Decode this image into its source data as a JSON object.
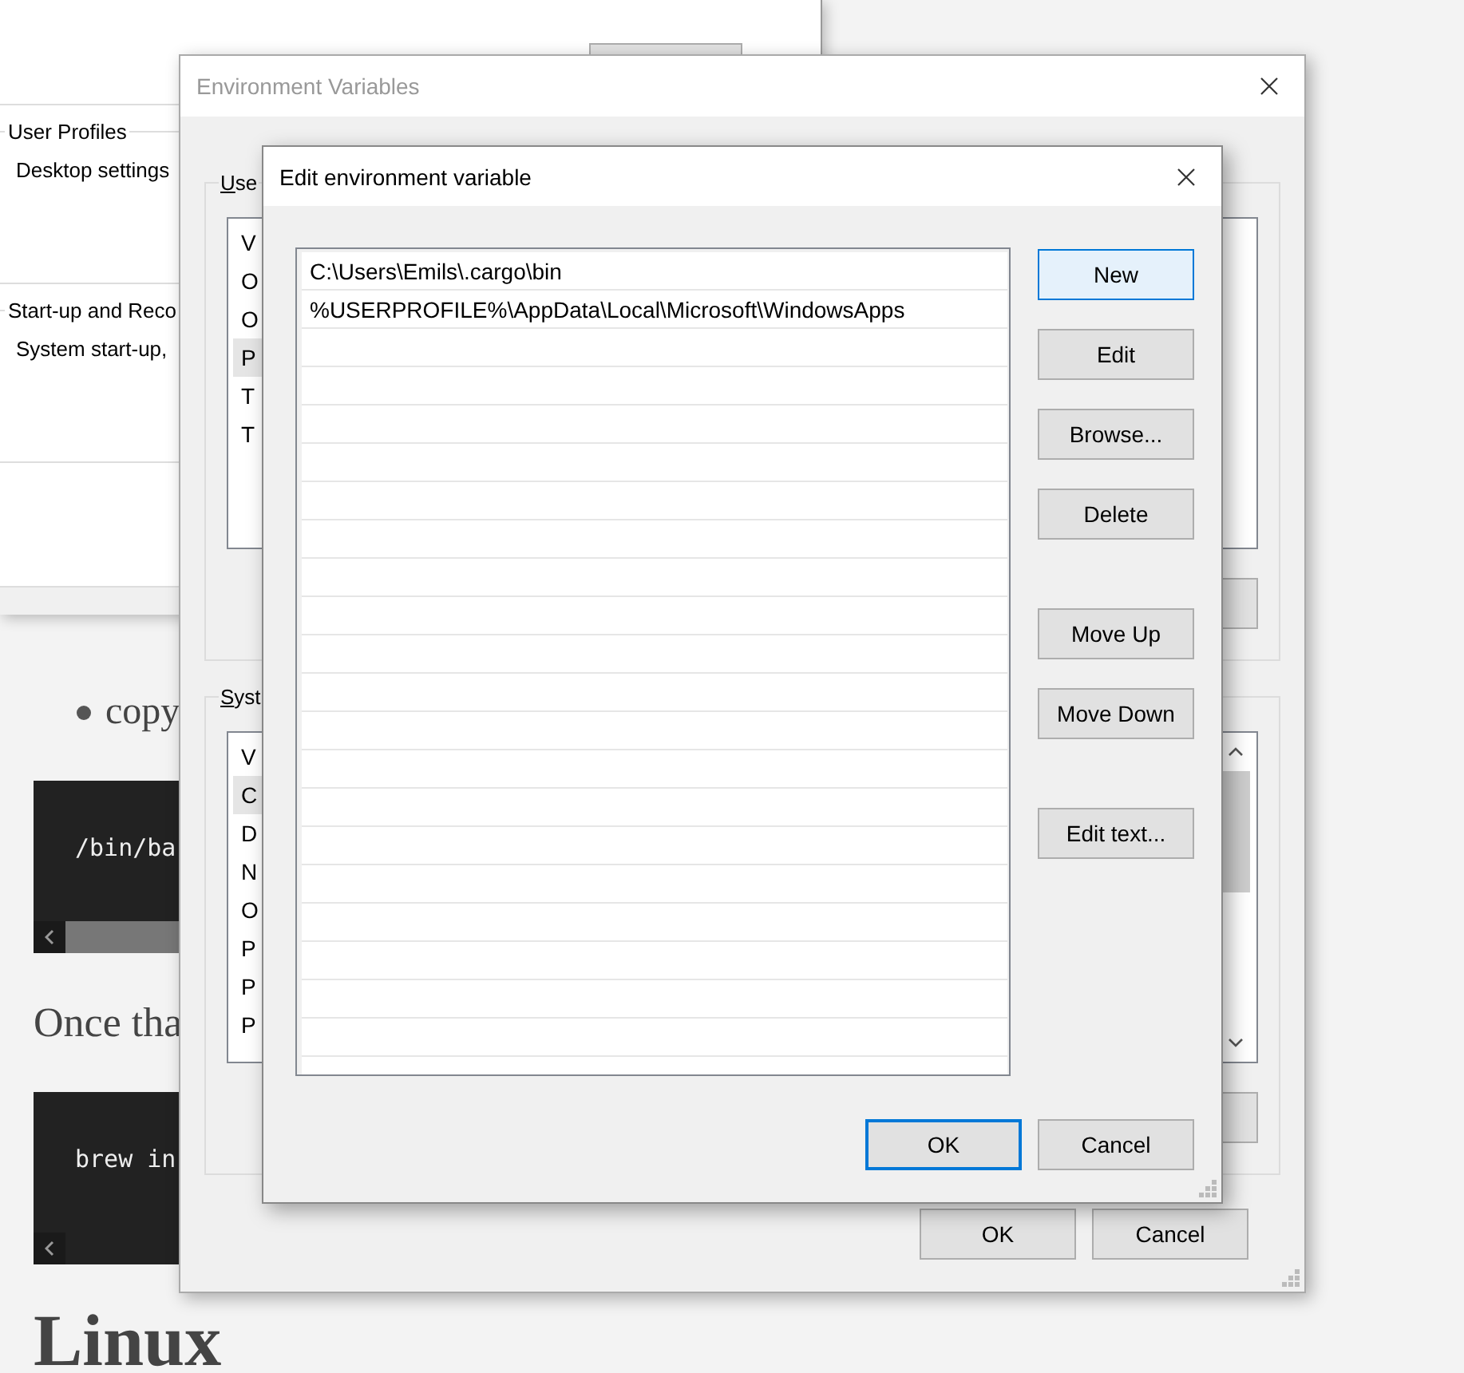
{
  "web_page": {
    "bullet_item": "copy",
    "code_blocks": [
      {
        "code": "/bin/ba"
      },
      {
        "code": "brew in"
      }
    ],
    "paragraph": "Once tha",
    "heading": "Linux"
  },
  "system_properties": {
    "groups": [
      {
        "title": "User Profiles",
        "description": "Desktop settings"
      },
      {
        "title": "Start-up and Reco",
        "description": "System start-up,"
      }
    ]
  },
  "environment_variables": {
    "title": "Environment Variables",
    "active": false,
    "user_variables": {
      "label": "Use",
      "column_header": "V",
      "rows": [
        {
          "text": "O",
          "selected": false
        },
        {
          "text": "O",
          "selected": false
        },
        {
          "text": "P",
          "selected": true
        },
        {
          "text": "T",
          "selected": false
        },
        {
          "text": "T",
          "selected": false
        }
      ]
    },
    "system_variables": {
      "label": "Syst",
      "column_header": "V",
      "rows": [
        {
          "text": "C",
          "selected": true
        },
        {
          "text": "D",
          "selected": false
        },
        {
          "text": "N",
          "selected": false
        },
        {
          "text": "O",
          "selected": false
        },
        {
          "text": "P",
          "selected": false
        },
        {
          "text": "P",
          "selected": false
        },
        {
          "text": "P",
          "selected": false
        }
      ]
    },
    "buttons": [
      {
        "label": "OK"
      },
      {
        "label": "Cancel"
      }
    ]
  },
  "edit_dialog": {
    "title": "Edit environment variable",
    "active": true,
    "entries": [
      {
        "text": "C:\\Users\\Emils\\.cargo\\bin"
      },
      {
        "text": "%USERPROFILE%\\AppData\\Local\\Microsoft\\WindowsApps"
      }
    ],
    "button_groups": [
      [
        {
          "label": "New",
          "highlighted": true
        },
        {
          "label": "Edit",
          "highlighted": false
        },
        {
          "label": "Browse...",
          "highlighted": false
        },
        {
          "label": "Delete",
          "highlighted": false
        }
      ],
      [
        {
          "label": "Move Up",
          "highlighted": false
        },
        {
          "label": "Move Down",
          "highlighted": false
        }
      ],
      [
        {
          "label": "Edit text...",
          "highlighted": false
        }
      ]
    ],
    "footer_buttons": [
      {
        "label": "OK",
        "default": true
      },
      {
        "label": "Cancel",
        "default": false
      }
    ]
  }
}
